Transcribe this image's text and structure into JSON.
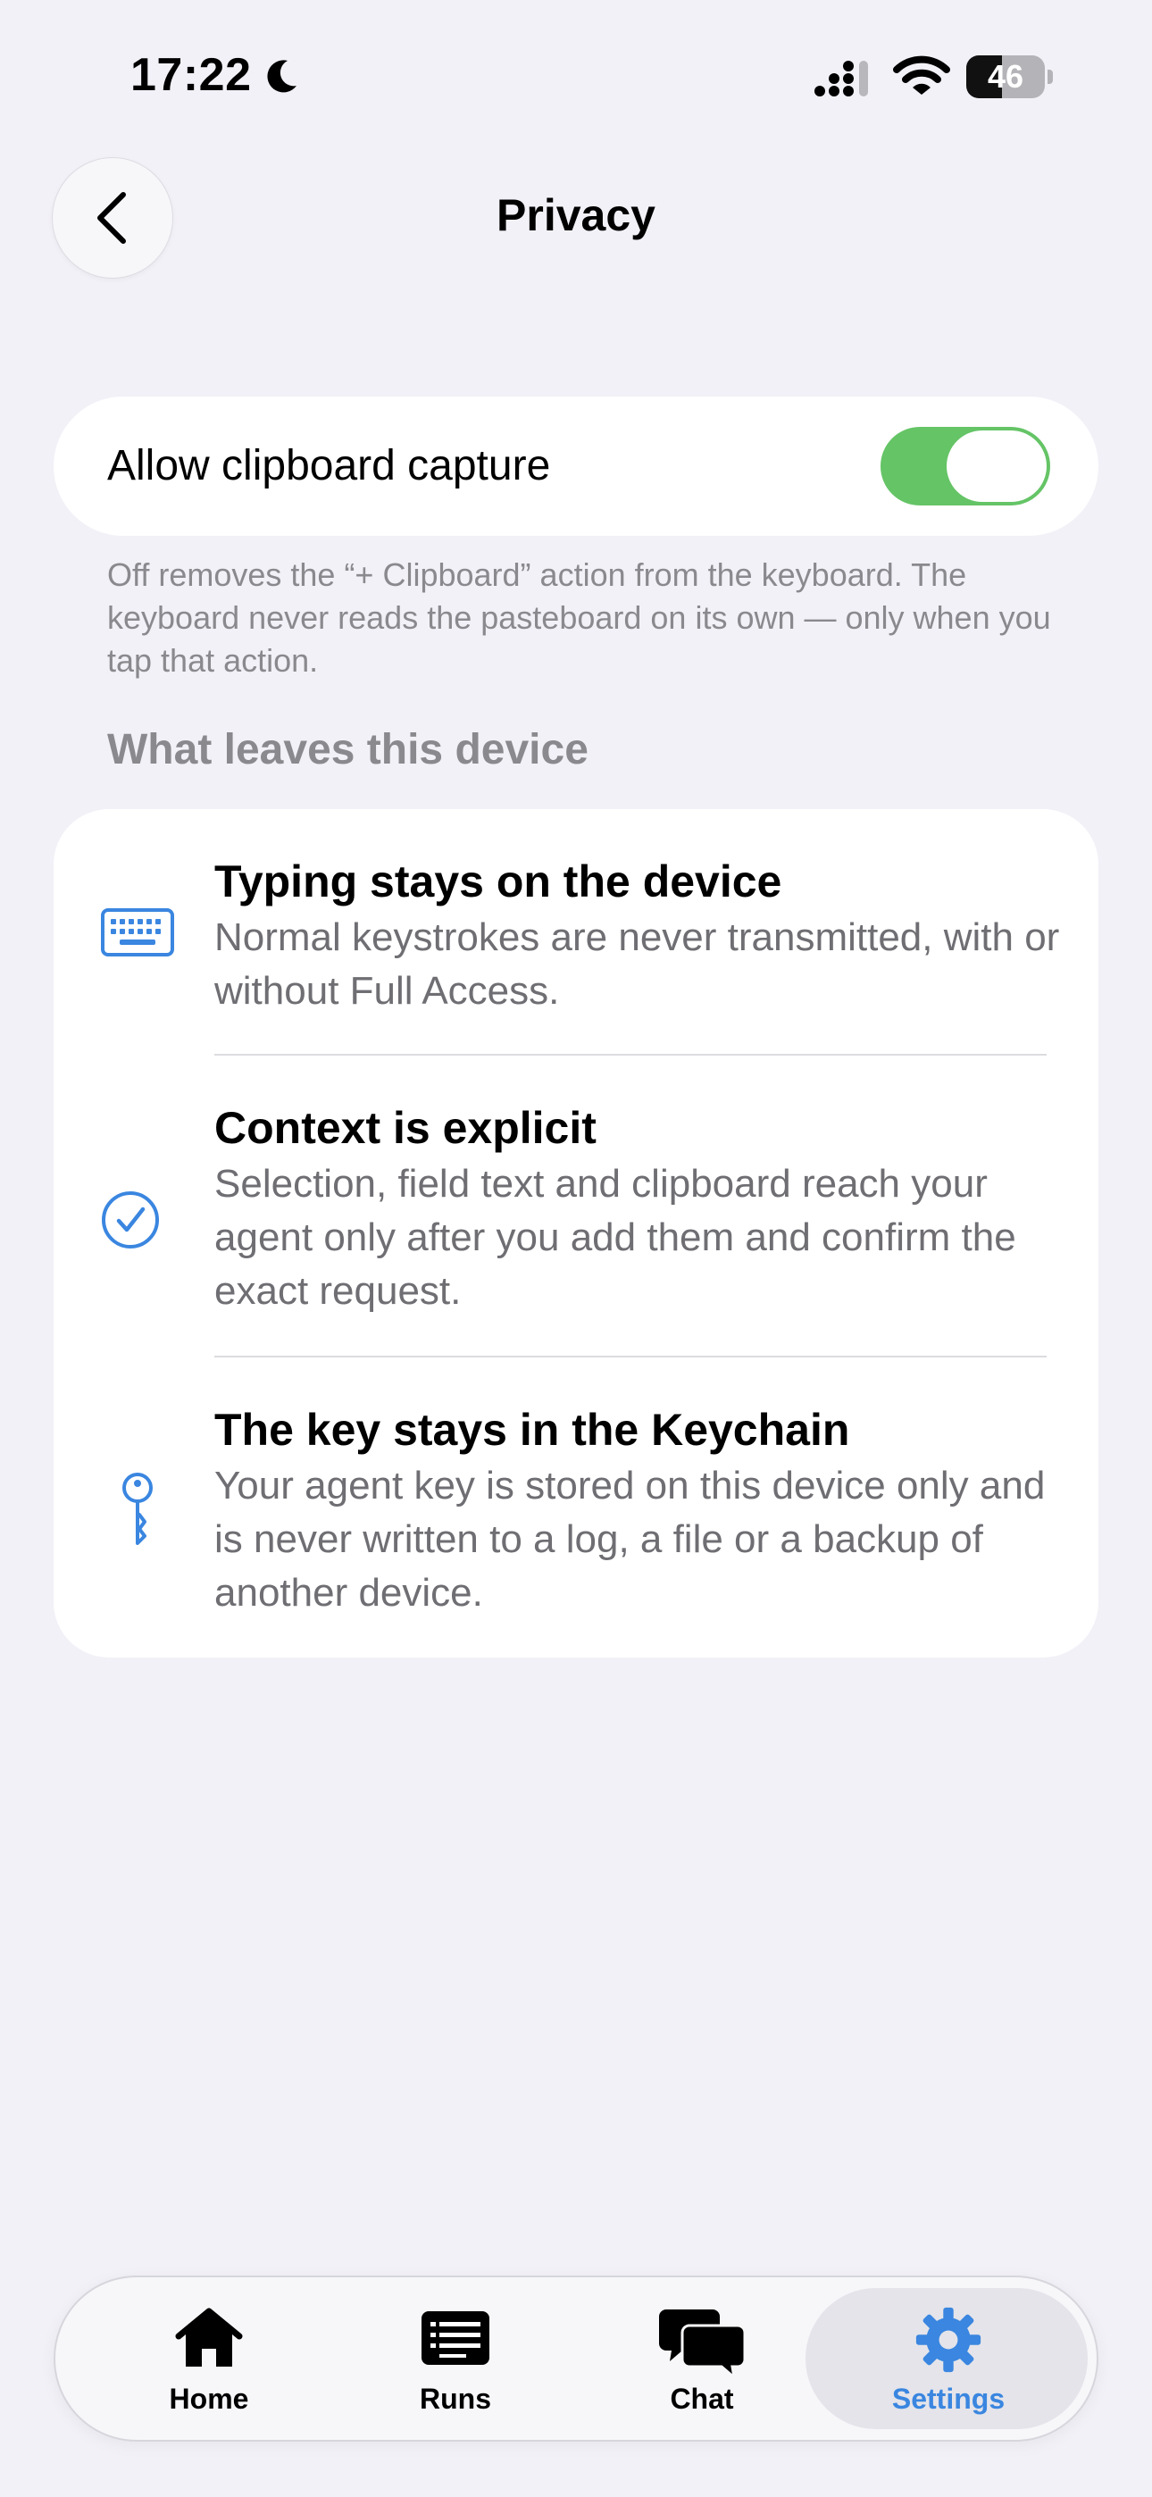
{
  "status_bar": {
    "time": "17:22",
    "battery_level": "46",
    "battery_fraction": 0.46,
    "icons": [
      "moon-icon",
      "signal-icon",
      "wifi-icon",
      "battery-icon"
    ]
  },
  "header": {
    "title": "Privacy",
    "back_icon": "chevron-left-icon"
  },
  "clipboard_setting": {
    "label": "Allow clipboard capture",
    "enabled": true,
    "footnote": "Off removes the “+ Clipboard” action from the keyboard. The keyboard never reads the pasteboard on its own — only when you tap that action."
  },
  "data_section": {
    "header": "What leaves this device",
    "items": [
      {
        "icon": "keyboard-icon",
        "title": "Typing stays on the device",
        "description": "Normal keystrokes are never transmitted, with or without Full Access."
      },
      {
        "icon": "checkmark-circle-icon",
        "title": "Context is explicit",
        "description": "Selection, field text and clipboard reach your agent only after you add them and confirm the exact request."
      },
      {
        "icon": "key-icon",
        "title": "The key stays in the Keychain",
        "description": "Your agent key is stored on this device only and is never written to a log, a file or a backup of another device."
      }
    ]
  },
  "tab_bar": {
    "active": "Settings",
    "tabs": [
      {
        "label": "Home",
        "icon": "house-icon"
      },
      {
        "label": "Runs",
        "icon": "list-icon"
      },
      {
        "label": "Chat",
        "icon": "chat-bubbles-icon"
      },
      {
        "label": "Settings",
        "icon": "gear-icon"
      }
    ]
  },
  "colors": {
    "background": "#f2f1f7",
    "accent": "#3a86e0",
    "toggle_on": "#65c466",
    "secondary_text": "#6e6e73"
  }
}
